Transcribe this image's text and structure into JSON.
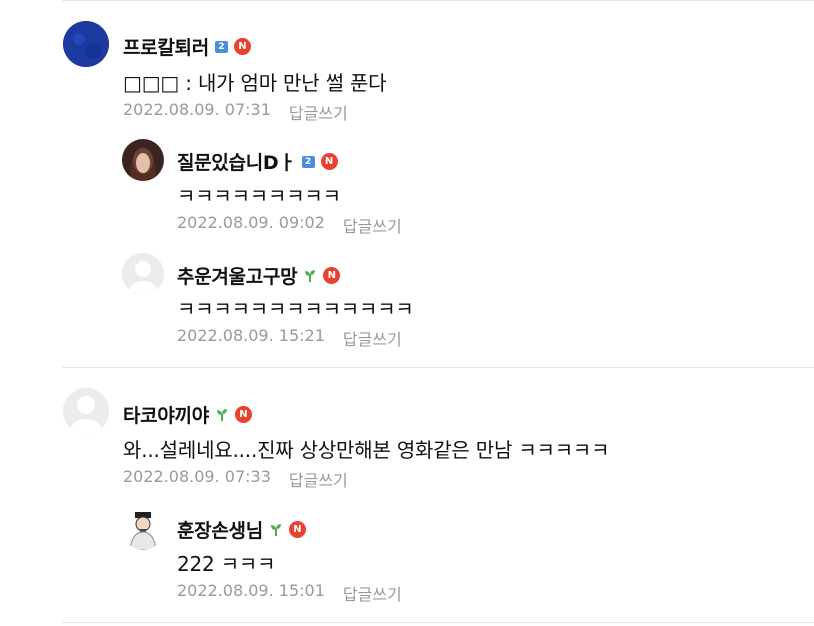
{
  "comments": [
    {
      "author": "프로칼퇴러",
      "level_badge": "2",
      "text": "□□□ : 내가 엄마 만난 썰 푼다",
      "date": "2022.08.09. 07:31",
      "reply_label": "답글쓰기",
      "replies": [
        {
          "author": "질문있습니Dㅏ",
          "level_badge": "2",
          "text": "ㅋㅋㅋㅋㅋㅋㅋㅋㅋ",
          "date": "2022.08.09. 09:02",
          "reply_label": "답글쓰기"
        },
        {
          "author": "추운겨울고구망",
          "level_badge": "sprout-icon",
          "text": "ㅋㅋㅋㅋㅋㅋㅋㅋㅋㅋㅋㅋㅋ",
          "date": "2022.08.09. 15:21",
          "reply_label": "답글쓰기"
        }
      ]
    },
    {
      "author": "타코야끼야",
      "level_badge": "sprout-icon",
      "text": "와...설레네요....진짜 상상만해본 영화같은 만남 ㅋㅋㅋㅋㅋ",
      "date": "2022.08.09. 07:33",
      "reply_label": "답글쓰기",
      "replies": [
        {
          "author": "훈장손생님",
          "level_badge": "sprout-icon",
          "text": "222 ㅋㅋㅋ",
          "date": "2022.08.09. 15:01",
          "reply_label": "답글쓰기"
        }
      ]
    }
  ],
  "n_badge": "N",
  "colors": {
    "n_badge": "#e8412f",
    "level_badge": "#4a8de0",
    "sprout": "#4caf50",
    "meta": "#999999"
  }
}
